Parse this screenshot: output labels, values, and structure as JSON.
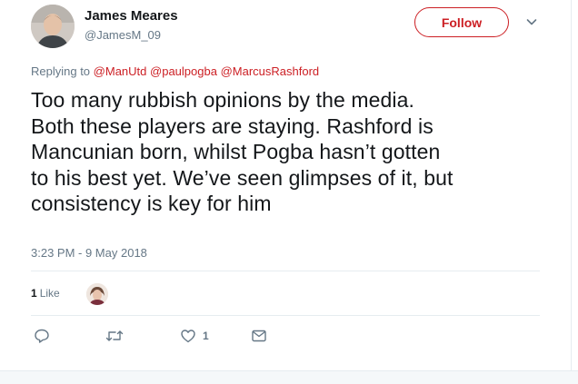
{
  "author": {
    "display_name": "James Meares",
    "handle": "@JamesM_09",
    "avatar_icon": "profile-photo"
  },
  "follow_label": "Follow",
  "replying": {
    "prefix": "Replying to",
    "mentions": [
      "@ManUtd",
      "@paulpogba",
      "@MarcusRashford"
    ]
  },
  "tweet_lines": [
    "Too many rubbish opinions by the media.",
    "Both these players are staying. Rashford is",
    "Mancunian born, whilst Pogba hasn’t gotten",
    "to his best yet. We’ve seen glimpses of it, but",
    "consistency is key for him"
  ],
  "timestamp": "3:23 PM - 9 May 2018",
  "stats": {
    "likes": "1",
    "likes_label": "Like"
  },
  "actions": {
    "reply_icon": "reply-icon",
    "retweet_icon": "retweet-icon",
    "like_icon": "heart-icon",
    "like_count": "1",
    "message_icon": "envelope-icon"
  },
  "colors": {
    "accent": "#cc1f24",
    "text": "#14171a",
    "muted": "#657786",
    "border": "#e6ecf0"
  }
}
